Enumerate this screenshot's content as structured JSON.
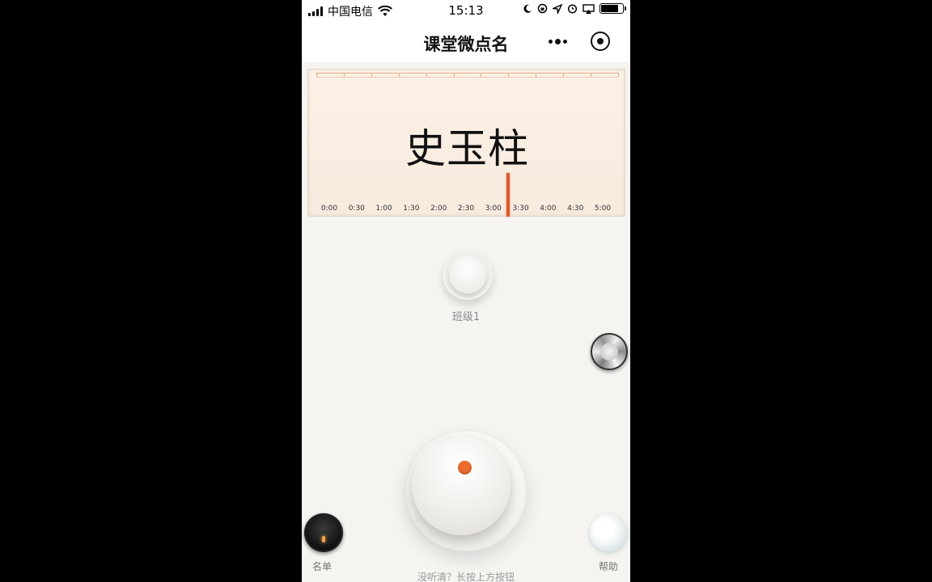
{
  "status_bar": {
    "carrier": "中国电信",
    "time": "15:13"
  },
  "nav": {
    "title": "课堂微点名",
    "more_icon": "more-dots-icon",
    "close_icon": "target-close-icon"
  },
  "display": {
    "name": "史玉柱",
    "scale_labels": [
      "0:00",
      "0:30",
      "1:00",
      "1:30",
      "2:00",
      "2:30",
      "3:00",
      "3:30",
      "4:00",
      "4:30",
      "5:00"
    ],
    "needle_color": "#dd5a2b"
  },
  "class_selector": {
    "label": "班级1"
  },
  "main_knob": {
    "indicator_color": "#ec6c2e"
  },
  "bottom": {
    "list_label": "名单",
    "help_label": "帮助",
    "hint": "没听清？长按上方按钮"
  }
}
